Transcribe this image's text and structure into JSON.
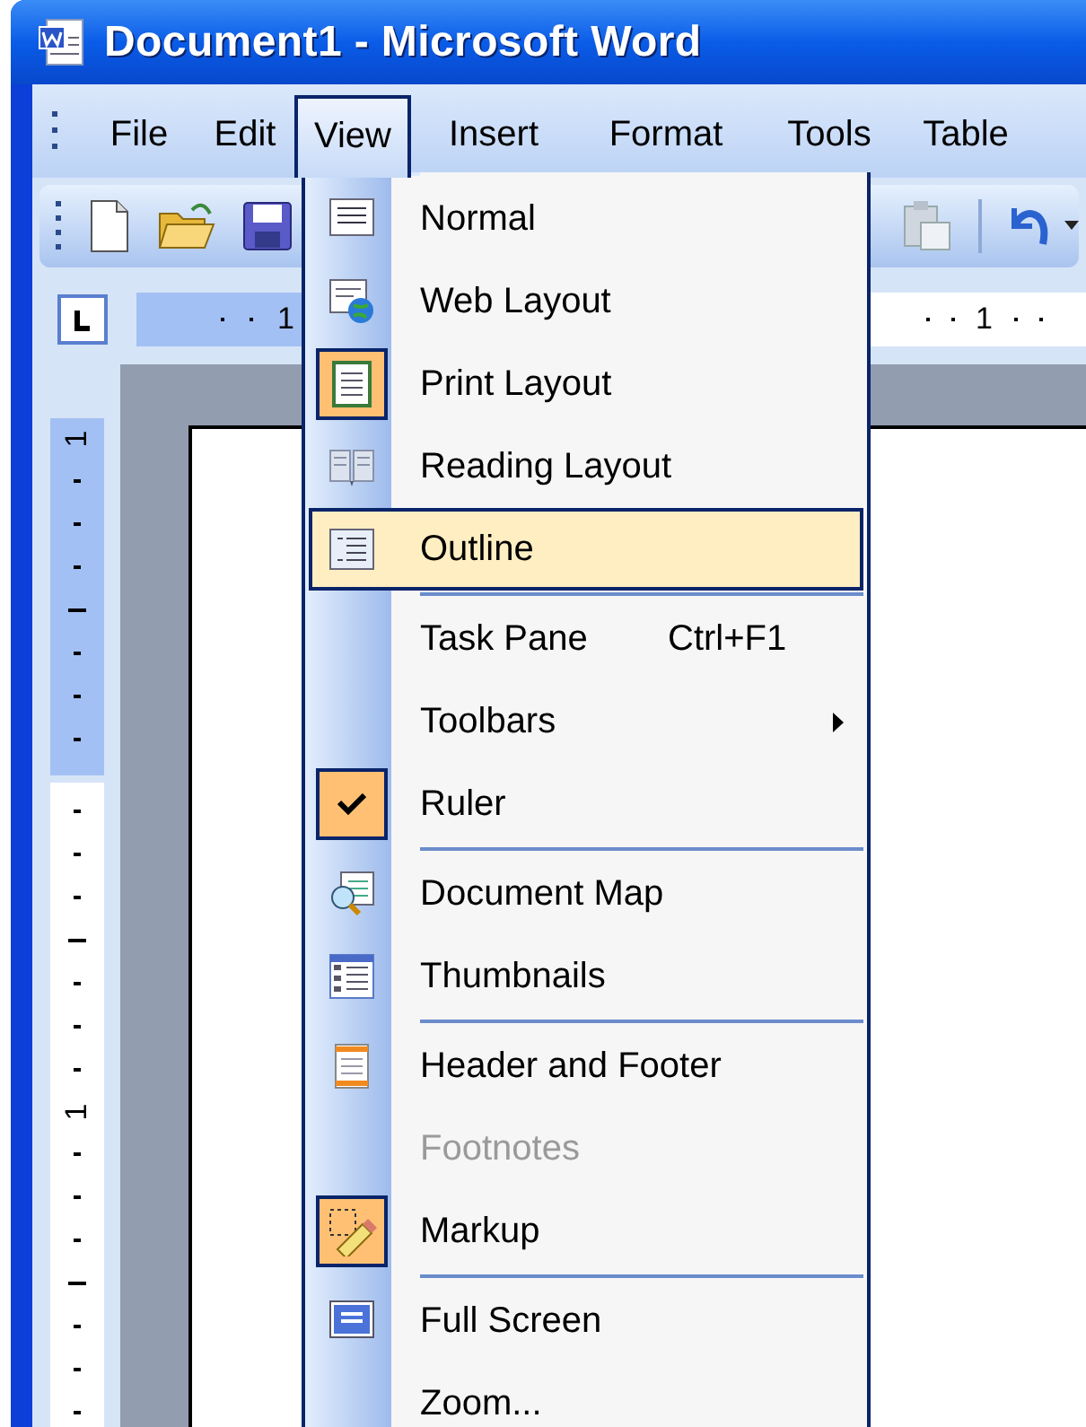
{
  "window": {
    "title": "Document1 - Microsoft Word"
  },
  "menu_bar": [
    {
      "label": "File",
      "selected": false
    },
    {
      "label": "Edit",
      "selected": false
    },
    {
      "label": "View",
      "selected": true
    },
    {
      "label": "Insert",
      "selected": false
    },
    {
      "label": "Format",
      "selected": false
    },
    {
      "label": "Tools",
      "selected": false
    },
    {
      "label": "Table",
      "selected": false
    }
  ],
  "ruler": {
    "horizontal_labels": [
      "1",
      "1"
    ],
    "vertical_labels": [
      "1",
      "1"
    ]
  },
  "view_menu": {
    "items": [
      {
        "kind": "item",
        "label": "Normal",
        "selected": false,
        "checked": false,
        "disabled": false
      },
      {
        "kind": "item",
        "label": "Web Layout",
        "selected": false,
        "checked": false,
        "disabled": false
      },
      {
        "kind": "item",
        "label": "Print Layout",
        "selected": false,
        "checked": true,
        "disabled": false
      },
      {
        "kind": "item",
        "label": "Reading Layout",
        "selected": false,
        "checked": false,
        "disabled": false
      },
      {
        "kind": "item",
        "label": "Outline",
        "selected": true,
        "checked": false,
        "disabled": false
      },
      {
        "kind": "separator"
      },
      {
        "kind": "item",
        "label": "Task Pane",
        "shortcut": "Ctrl+F1",
        "selected": false,
        "checked": false,
        "disabled": false
      },
      {
        "kind": "item",
        "label": "Toolbars",
        "submenu": true,
        "selected": false,
        "checked": false,
        "disabled": false
      },
      {
        "kind": "item",
        "label": "Ruler",
        "selected": false,
        "checked": true,
        "disabled": false
      },
      {
        "kind": "separator"
      },
      {
        "kind": "item",
        "label": "Document Map",
        "selected": false,
        "checked": false,
        "disabled": false
      },
      {
        "kind": "item",
        "label": "Thumbnails",
        "selected": false,
        "checked": false,
        "disabled": false
      },
      {
        "kind": "separator"
      },
      {
        "kind": "item",
        "label": "Header and Footer",
        "selected": false,
        "checked": false,
        "disabled": false
      },
      {
        "kind": "item",
        "label": "Footnotes",
        "selected": false,
        "checked": false,
        "disabled": true
      },
      {
        "kind": "item",
        "label": "Markup",
        "selected": false,
        "checked": true,
        "disabled": false
      },
      {
        "kind": "separator"
      },
      {
        "kind": "item",
        "label": "Full Screen",
        "selected": false,
        "checked": false,
        "disabled": false
      },
      {
        "kind": "item",
        "label": "Zoom...",
        "selected": false,
        "checked": false,
        "disabled": false
      }
    ]
  }
}
